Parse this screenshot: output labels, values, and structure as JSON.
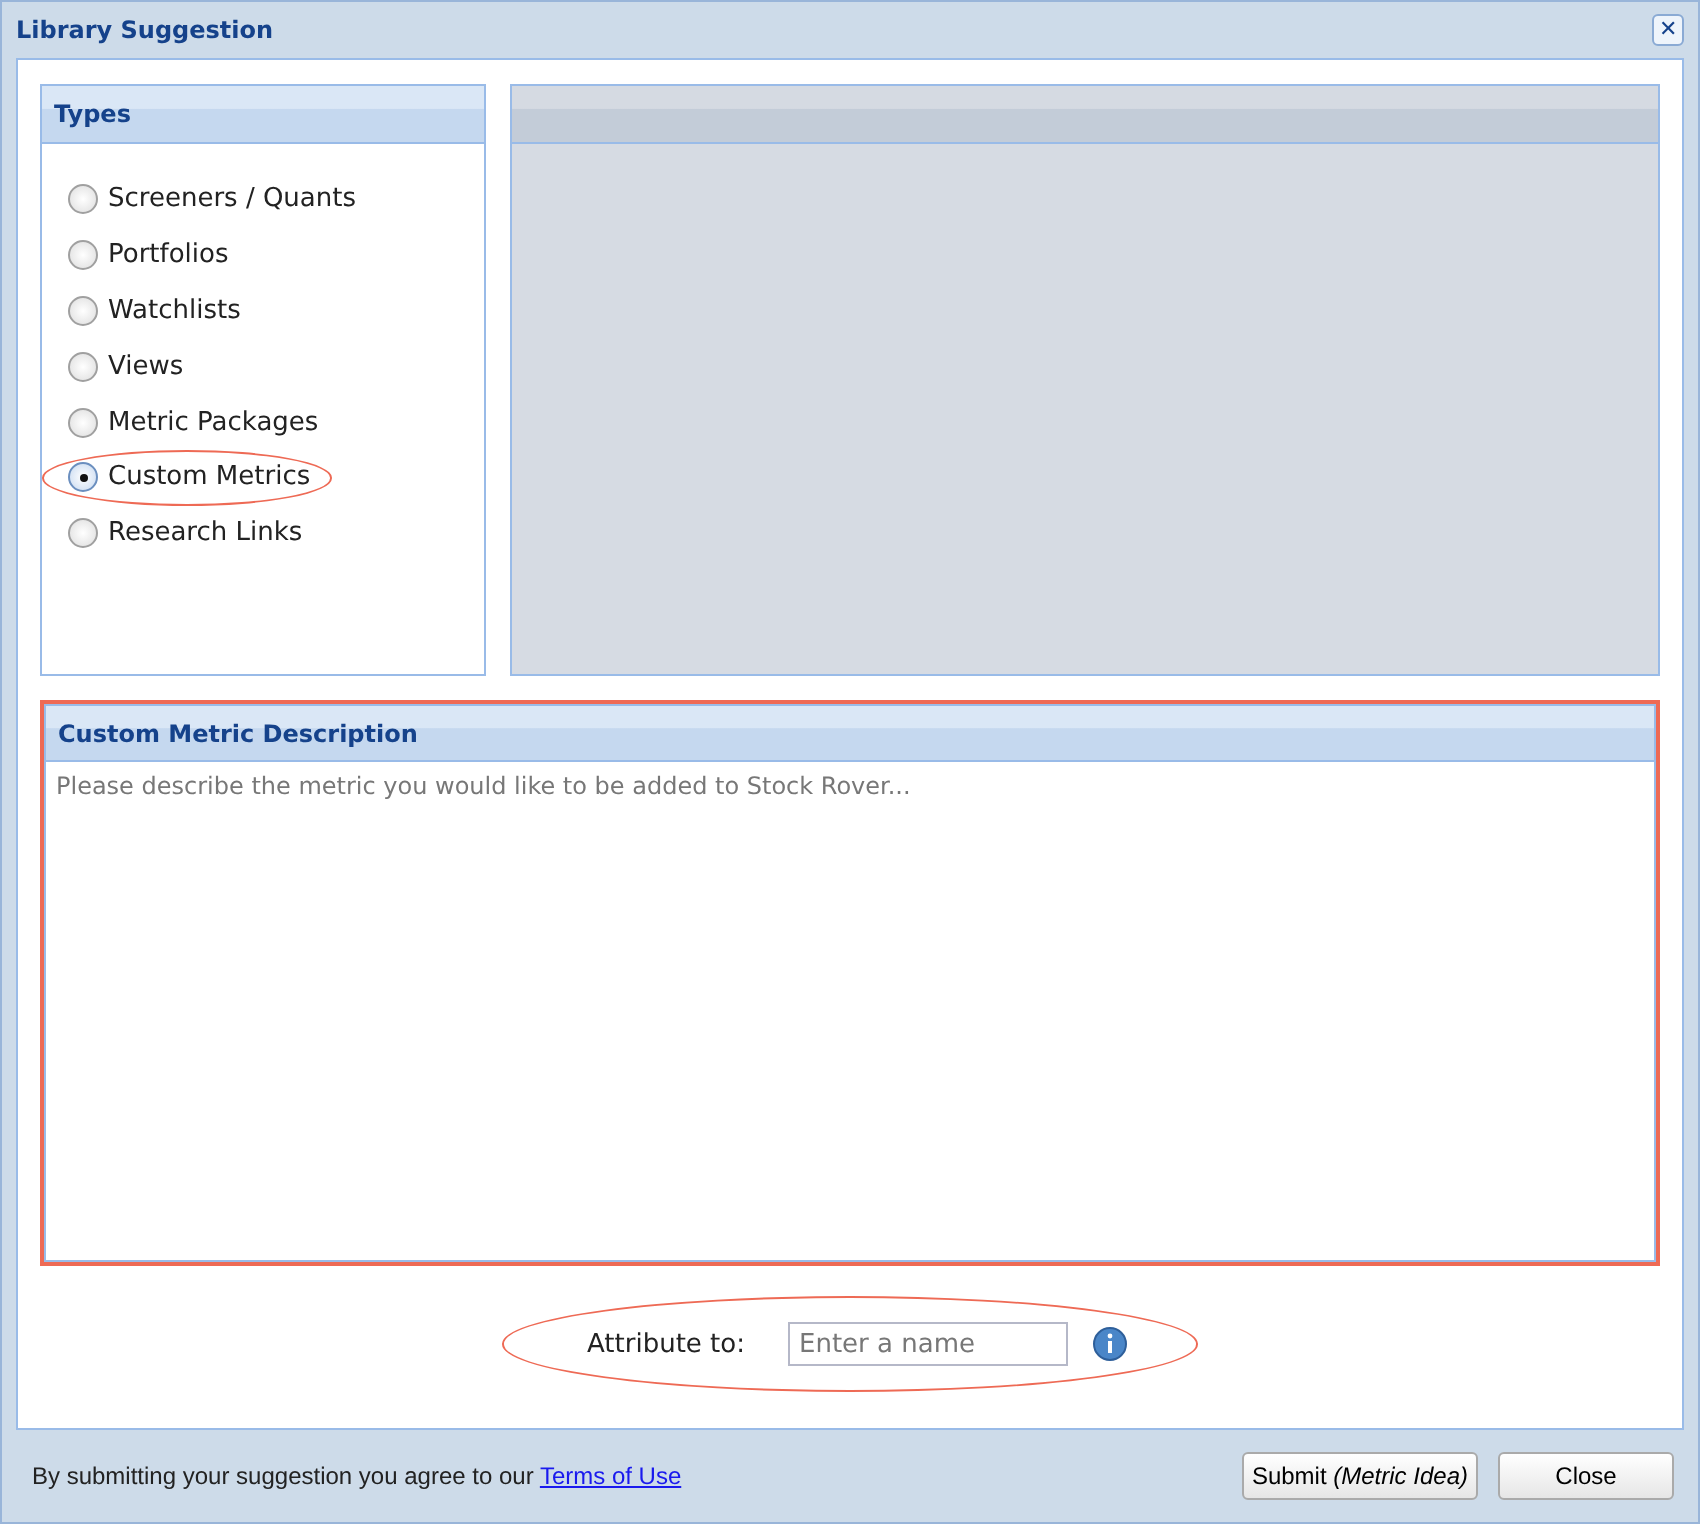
{
  "window": {
    "title": "Library Suggestion",
    "close": "✕"
  },
  "types": {
    "title": "Types",
    "items": [
      {
        "label": "Screeners / Quants",
        "selected": false,
        "highlighted": false
      },
      {
        "label": "Portfolios",
        "selected": false,
        "highlighted": false
      },
      {
        "label": "Watchlists",
        "selected": false,
        "highlighted": false
      },
      {
        "label": "Views",
        "selected": false,
        "highlighted": false
      },
      {
        "label": "Metric Packages",
        "selected": false,
        "highlighted": false
      },
      {
        "label": "Custom Metrics",
        "selected": true,
        "highlighted": true
      },
      {
        "label": "Research Links",
        "selected": false,
        "highlighted": false
      }
    ]
  },
  "description": {
    "title": "Custom Metric Description",
    "placeholder": "Please describe the metric you would like to be added to Stock Rover...",
    "highlighted": true
  },
  "attribute": {
    "label": "Attribute to:",
    "placeholder": "Enter a name",
    "highlighted": true
  },
  "footer": {
    "text": "By submitting your suggestion you agree to our",
    "link": "Terms of Use",
    "buttons": [
      "Submit *(Metric Idea)*",
      "Close"
    ]
  }
}
